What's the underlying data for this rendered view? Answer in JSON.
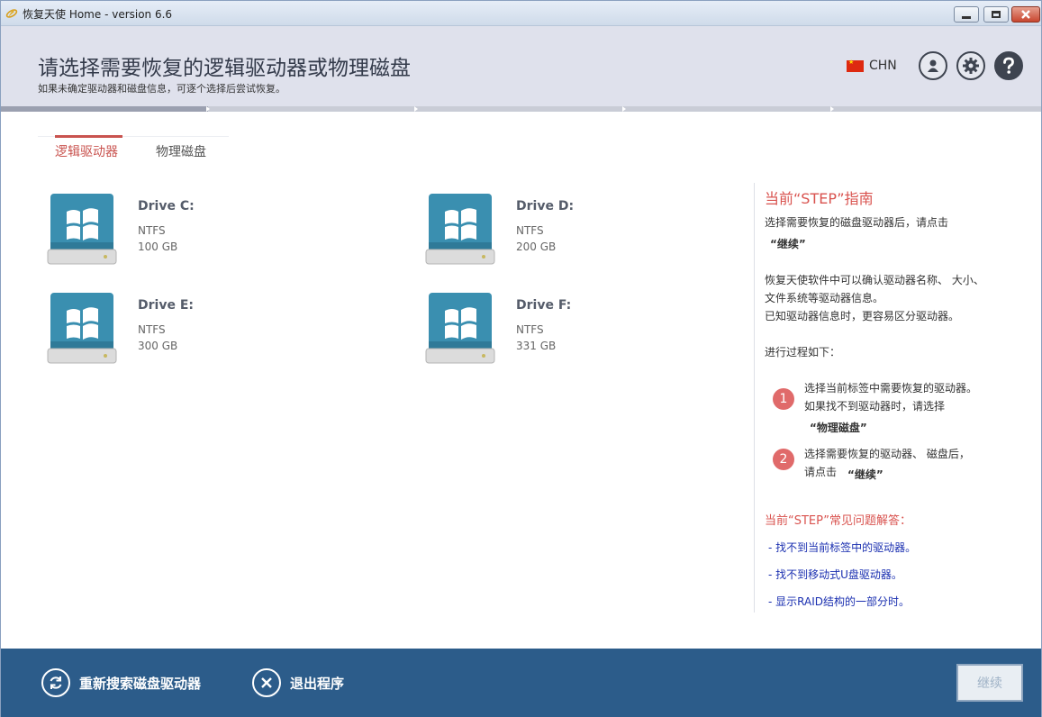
{
  "window": {
    "title": "恢复天使 Home - version 6.6"
  },
  "header": {
    "title": "请选择需要恢复的逻辑驱动器或物理磁盘",
    "subtitle": "如果未确定驱动器和磁盘信息，可逐个选择后尝试恢复。",
    "language": "CHN"
  },
  "tabs": [
    {
      "label": "逻辑驱动器",
      "active": true
    },
    {
      "label": "物理磁盘",
      "active": false
    }
  ],
  "drives": [
    {
      "name": "Drive C:",
      "fs": "NTFS",
      "size": "100 GB"
    },
    {
      "name": "Drive D:",
      "fs": "NTFS",
      "size": "200 GB"
    },
    {
      "name": "Drive E:",
      "fs": "NTFS",
      "size": "300 GB"
    },
    {
      "name": "Drive F:",
      "fs": "NTFS",
      "size": "331 GB"
    }
  ],
  "guide": {
    "title": "当前“STEP”指南",
    "intro": "选择需要恢复的磁盘驱动器后，请点击",
    "intro_bold": "“继续”",
    "para_line1": "恢复天使软件中可以确认驱动器名称、 大小、",
    "para_line2": "文件系统等驱动器信息。",
    "para_line3": "已知驱动器信息时，更容易区分驱动器。",
    "process": "进行过程如下：",
    "step1_num": "1",
    "step1_line1": "选择当前标签中需要恢复的驱动器。",
    "step1_line2": "如果找不到驱动器时，请选择",
    "step1_bold": "“物理磁盘”",
    "step2_num": "2",
    "step2_line1": "选择需要恢复的驱动器、 磁盘后，",
    "step2_line2": "请点击",
    "step2_bold": "“继续”",
    "faq_title": "当前“STEP”常见问题解答：",
    "faq": [
      "- 找不到当前标签中的驱动器。",
      "- 找不到移动式U盘驱动器。",
      "- 显示RAID结构的一部分时。"
    ]
  },
  "footer": {
    "rescan_label": "重新搜索磁盘驱动器",
    "exit_label": "退出程序",
    "continue_label": "继续"
  },
  "colors": {
    "accent": "#c9534f",
    "footer_bg": "#2c5c8a",
    "header_bg": "#dfe1ec",
    "link": "#1a2fb0"
  },
  "icons": [
    "app-icon",
    "china-flag-icon",
    "user-icon",
    "gear-icon",
    "help-icon",
    "windows-drive-icon",
    "refresh-icon",
    "close-circle-icon"
  ]
}
